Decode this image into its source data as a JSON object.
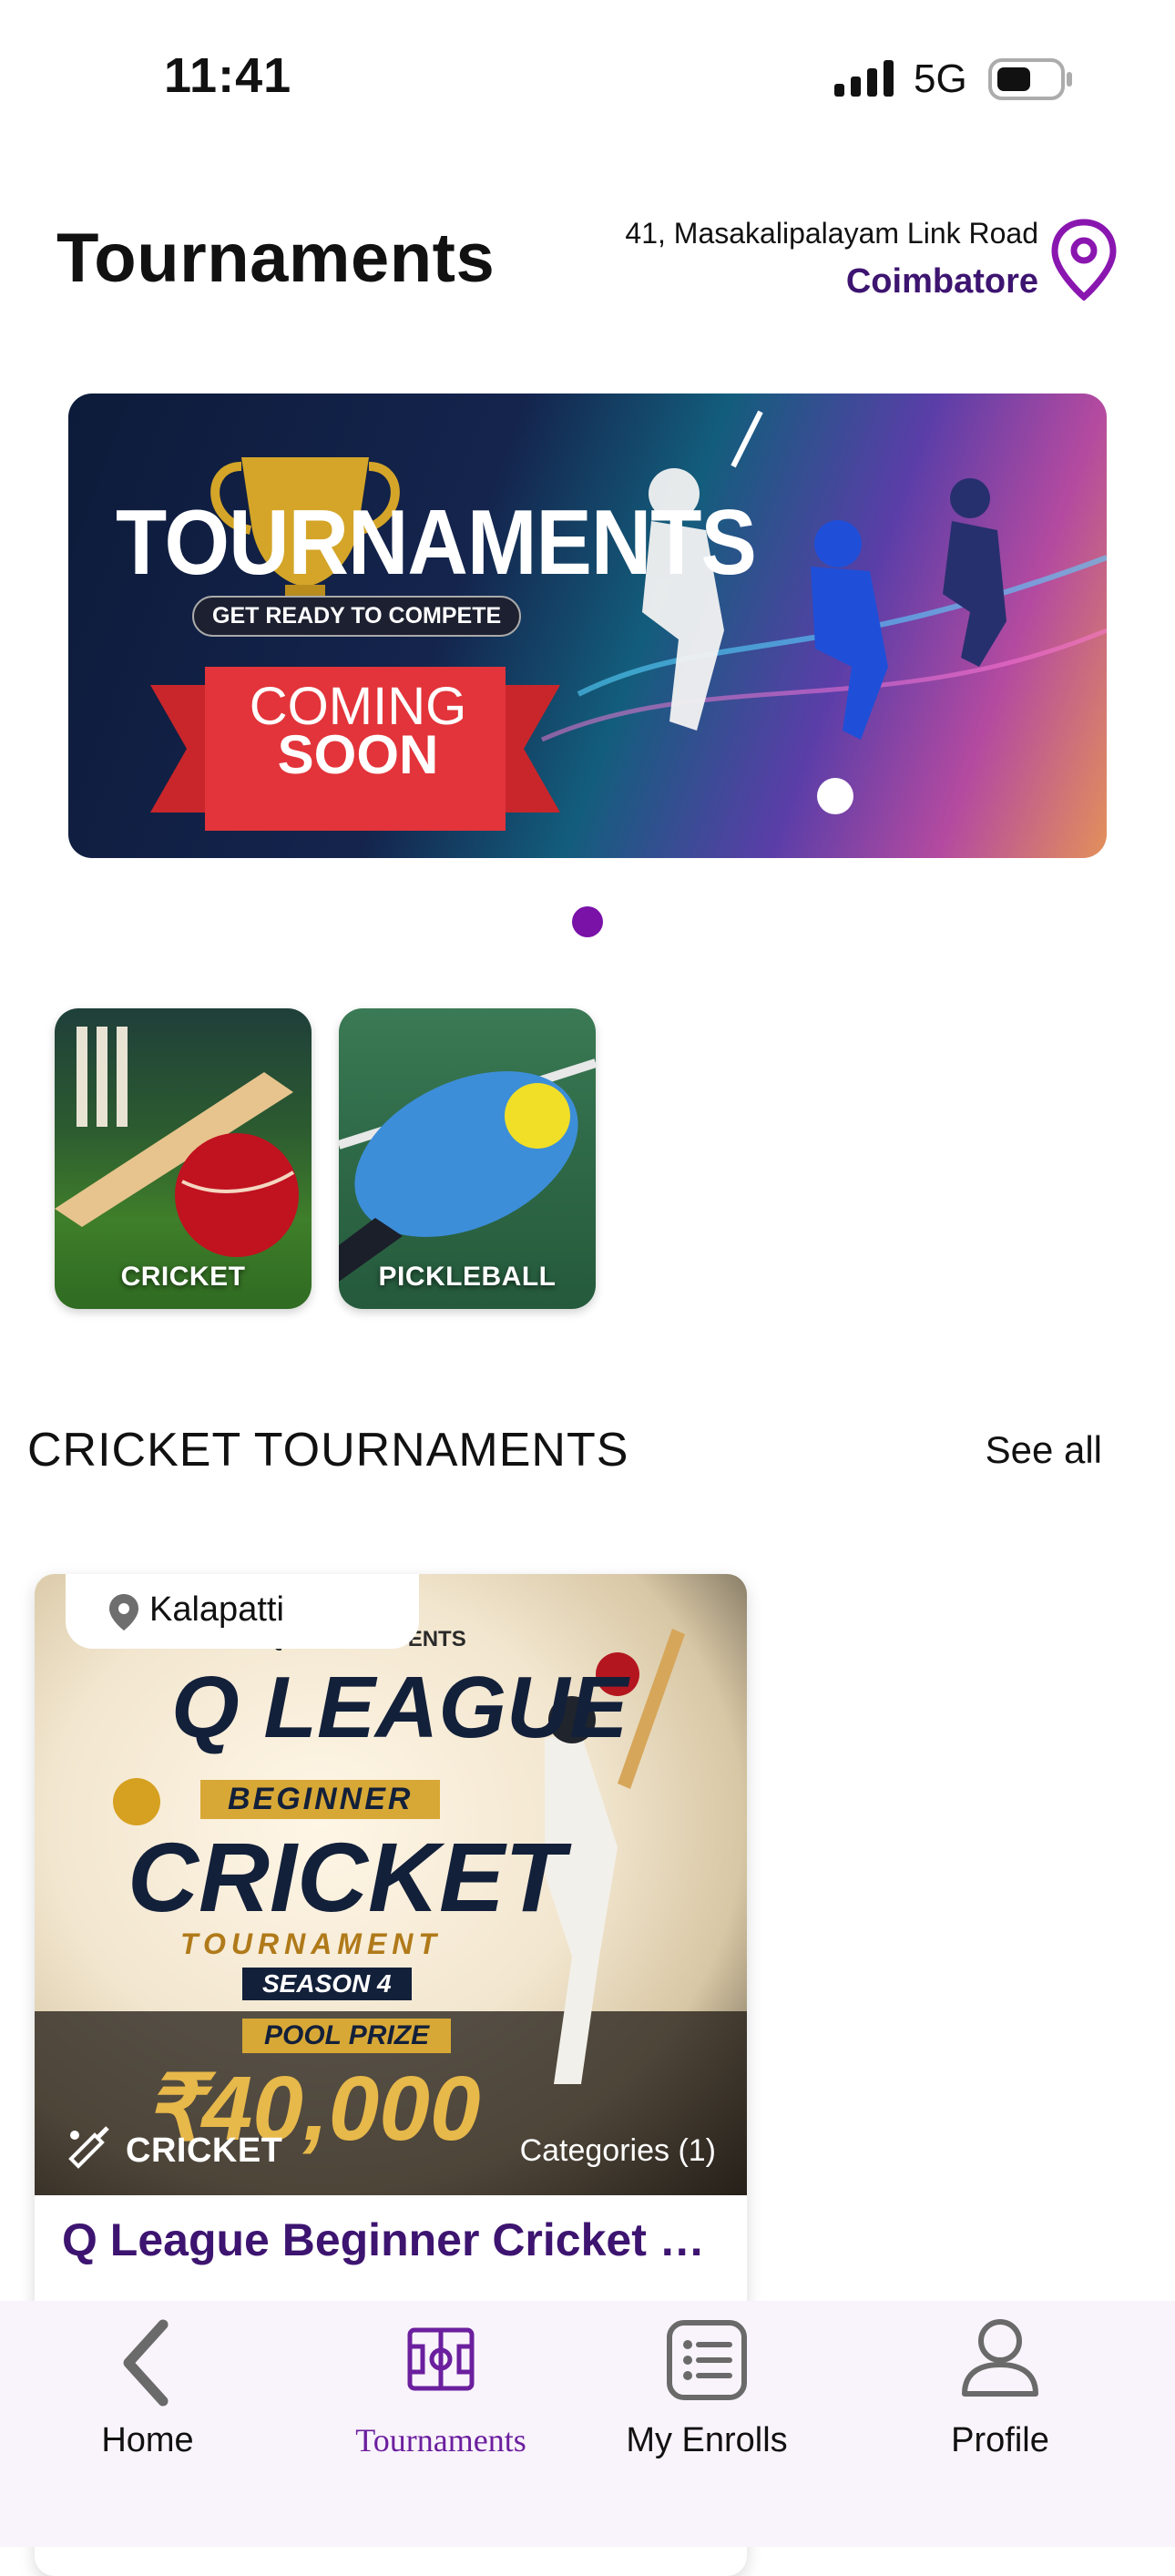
{
  "status": {
    "time": "11:41",
    "network": "5G"
  },
  "header": {
    "title": "Tournaments",
    "address_line": "41, Masakalipalayam Link Road",
    "city": "Coimbatore"
  },
  "banner": {
    "headline": "TOURNAMENTS",
    "tagline": "GET READY TO COMPETE",
    "coming": "COMING",
    "soon": "SOON"
  },
  "categories": [
    {
      "label": "CRICKET"
    },
    {
      "label": "PICKLEBALL"
    }
  ],
  "section": {
    "title": "CRICKET TOURNAMENTS",
    "see_all": "See all"
  },
  "card": {
    "location": "Kalapatti",
    "presents": "QUEST PRESENTS",
    "poster_line1": "Q LEAGUE",
    "poster_line2": "BEGINNER",
    "poster_line3": "CRICKET",
    "poster_line4": "TOURNAMENT",
    "poster_line5": "SEASON 4",
    "poster_prize_label": "POOL PRIZE",
    "poster_prize": "₹40,000",
    "sport": "CRICKET",
    "categories": "Categories (1)",
    "title": "Q League Beginner Cricket T..."
  },
  "tabs": [
    {
      "label": "Home",
      "icon": "back-chevron-icon"
    },
    {
      "label": "Tournaments",
      "icon": "field-icon"
    },
    {
      "label": "My Enrolls",
      "icon": "list-icon"
    },
    {
      "label": "Profile",
      "icon": "person-icon"
    }
  ],
  "colors": {
    "accent": "#6b1f9e",
    "city": "#3d1470",
    "active_dot": "#7a12a8"
  }
}
